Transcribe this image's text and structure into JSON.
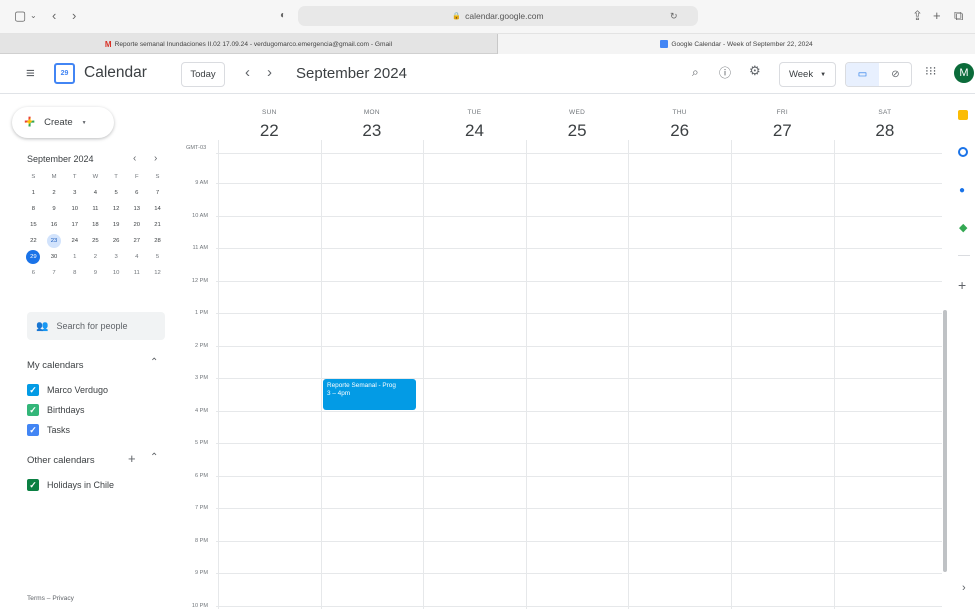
{
  "browser": {
    "url": "calendar.google.com",
    "tabs": [
      {
        "label": "Reporte semanal Inundaciones II.02 17.09.24 - verdugomarco.emergencia@gmail.com - Gmail"
      },
      {
        "label": "Google Calendar - Week of September 22, 2024"
      }
    ]
  },
  "header": {
    "app_name": "Calendar",
    "logo_day": "29",
    "today_label": "Today",
    "period_title": "September 2024",
    "view_select": "Week",
    "avatar_initial": "M"
  },
  "sidebar": {
    "create_label": "Create",
    "mini_month": {
      "title": "September 2024",
      "weekdays": [
        "S",
        "M",
        "T",
        "W",
        "T",
        "F",
        "S"
      ],
      "weeks": [
        [
          "1",
          "2",
          "3",
          "4",
          "5",
          "6",
          "7"
        ],
        [
          "8",
          "9",
          "10",
          "11",
          "12",
          "13",
          "14"
        ],
        [
          "15",
          "16",
          "17",
          "18",
          "19",
          "20",
          "21"
        ],
        [
          "22",
          "23",
          "24",
          "25",
          "26",
          "27",
          "28"
        ],
        [
          "29",
          "30",
          "1",
          "2",
          "3",
          "4",
          "5"
        ],
        [
          "6",
          "7",
          "8",
          "9",
          "10",
          "11",
          "12"
        ]
      ]
    },
    "search_people_placeholder": "Search for people",
    "my_calendars_title": "My calendars",
    "my_calendars": [
      {
        "label": "Marco Verdugo",
        "color": "#039be5"
      },
      {
        "label": "Birthdays",
        "color": "#33b679"
      },
      {
        "label": "Tasks",
        "color": "#4285f4"
      }
    ],
    "other_calendars_title": "Other calendars",
    "other_calendars": [
      {
        "label": "Holidays in Chile",
        "color": "#0b8043"
      }
    ],
    "footer_terms": "Terms",
    "footer_sep": "–",
    "footer_privacy": "Privacy"
  },
  "week": {
    "timezone": "GMT-03",
    "days": [
      {
        "dow": "SUN",
        "num": "22"
      },
      {
        "dow": "MON",
        "num": "23"
      },
      {
        "dow": "TUE",
        "num": "24"
      },
      {
        "dow": "WED",
        "num": "25"
      },
      {
        "dow": "THU",
        "num": "26"
      },
      {
        "dow": "FRI",
        "num": "27"
      },
      {
        "dow": "SAT",
        "num": "28"
      }
    ],
    "hours": [
      "9 AM",
      "10 AM",
      "11 AM",
      "12 PM",
      "1 PM",
      "2 PM",
      "3 PM",
      "4 PM",
      "5 PM",
      "6 PM",
      "7 PM",
      "8 PM",
      "9 PM",
      "10 PM"
    ]
  },
  "event": {
    "title": "Reporte Semanal - Prog",
    "time": "3 – 4pm",
    "color": "#039be5"
  }
}
